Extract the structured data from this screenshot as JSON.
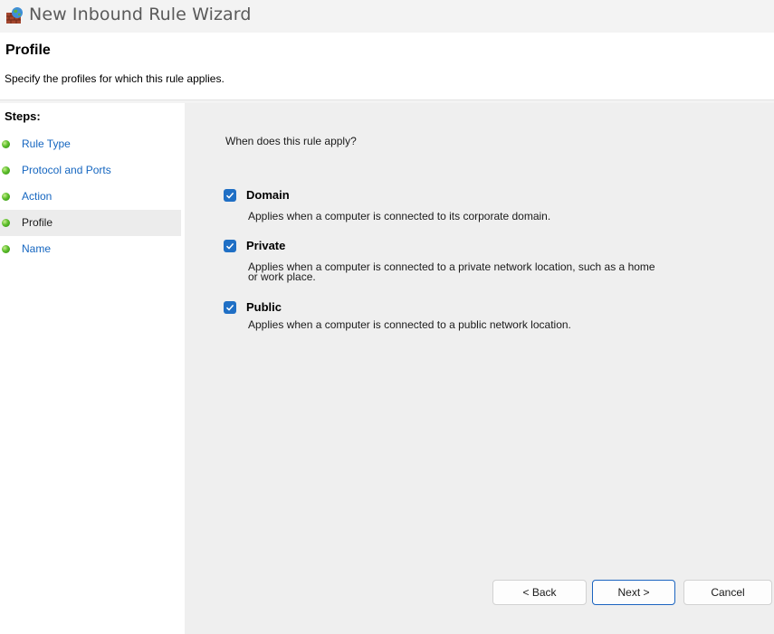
{
  "window": {
    "title": "New Inbound Rule Wizard",
    "icon": "firewall-globe-icon"
  },
  "header": {
    "title": "Profile",
    "description": "Specify the profiles for which this rule applies."
  },
  "steps": {
    "title": "Steps:",
    "items": [
      {
        "label": "Rule Type",
        "current": false
      },
      {
        "label": "Protocol and Ports",
        "current": false
      },
      {
        "label": "Action",
        "current": false
      },
      {
        "label": "Profile",
        "current": true
      },
      {
        "label": "Name",
        "current": false
      }
    ]
  },
  "main": {
    "question": "When does this rule apply?",
    "options": [
      {
        "label": "Domain",
        "checked": true,
        "description": "Applies when a computer is connected to its corporate domain."
      },
      {
        "label": "Private",
        "checked": true,
        "description_line1": "Applies when a computer is connected to a private network location, such as a home",
        "description_line2": "or work place."
      },
      {
        "label": "Public",
        "checked": true,
        "description": "Applies when a computer is connected to a public network location."
      }
    ]
  },
  "buttons": {
    "back": "< Back",
    "next": "Next >",
    "cancel": "Cancel"
  },
  "colors": {
    "accent": "#1f6fc5",
    "link": "#1566c0",
    "step_dot": "#4caf28"
  }
}
